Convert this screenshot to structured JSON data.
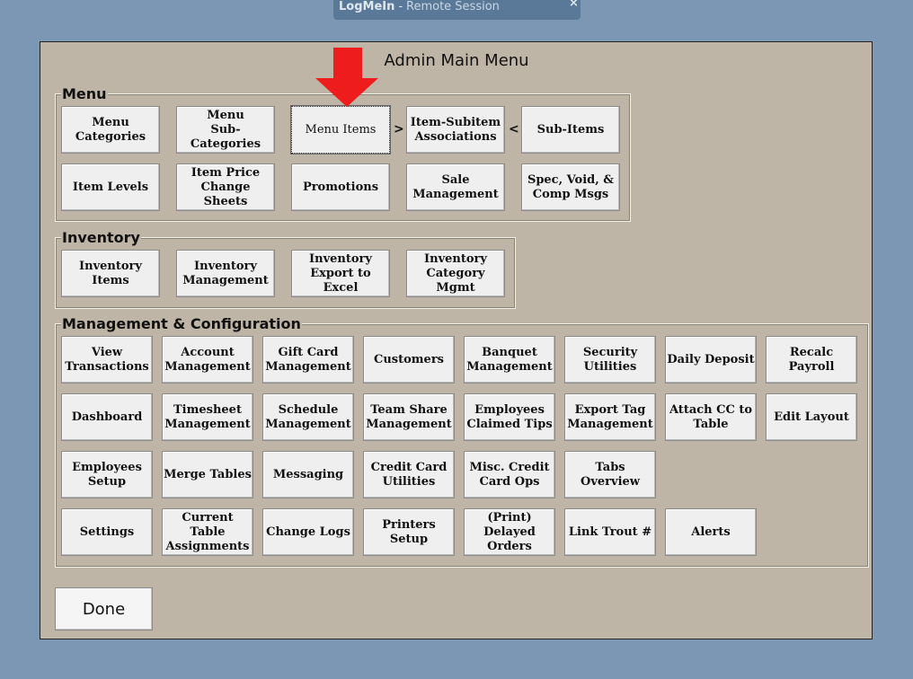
{
  "remote": {
    "brand": "LogMeIn",
    "dash": " - ",
    "session": "Remote Session",
    "close": "×"
  },
  "dialog": {
    "title": "Admin Main Menu",
    "done": "Done"
  },
  "menu": {
    "legend": "Menu",
    "row1": [
      "Menu\nCategories",
      "Menu\nSub-Categories",
      "Menu Items",
      "Item-Subitem\nAssociations",
      "Sub-Items"
    ],
    "sep1": ">",
    "sep2": "<",
    "row2": [
      "Item Levels",
      "Item Price\nChange Sheets",
      "Promotions",
      "Sale\nManagement",
      "Spec, Void, &\nComp Msgs"
    ]
  },
  "inventory": {
    "legend": "Inventory",
    "buttons": [
      "Inventory\nItems",
      "Inventory\nManagement",
      "Inventory\nExport to Excel",
      "Inventory\nCategory Mgmt"
    ]
  },
  "management": {
    "legend": "Management & Configuration",
    "row1": [
      "View\nTransactions",
      "Account\nManagement",
      "Gift Card\nManagement",
      "Customers",
      "Banquet\nManagement",
      "Security\nUtilities",
      "Daily Deposit",
      "Recalc Payroll"
    ],
    "row2": [
      "Dashboard",
      "Timesheet\nManagement",
      "Schedule\nManagement",
      "Team Share\nManagement",
      "Employees\nClaimed Tips",
      "Export Tag\nManagement",
      "Attach CC to\nTable",
      "Edit Layout"
    ],
    "row3": [
      "Employees\nSetup",
      "Merge Tables",
      "Messaging",
      "Credit Card\nUtilities",
      "Misc. Credit\nCard Ops",
      "Tabs\nOverview"
    ],
    "row4": [
      "Settings",
      "Current Table\nAssignments",
      "Change Logs",
      "Printers Setup",
      "(Print)\nDelayed\nOrders",
      "Link Trout #",
      "Alerts"
    ]
  },
  "colors": {
    "arrow": "#ee1c1c",
    "panel": "#bfb5a6",
    "button": "#efefef"
  },
  "icons": {
    "annotation": "red-down-arrow-icon"
  }
}
